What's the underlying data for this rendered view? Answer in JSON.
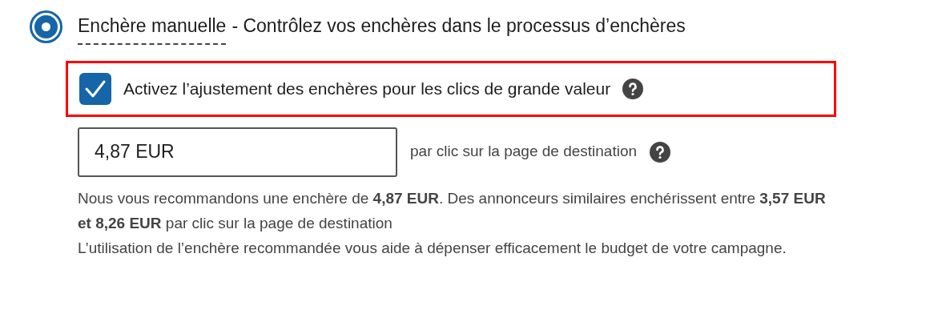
{
  "bid_option": {
    "selected": true,
    "term": "Enchère manuelle",
    "description": "- Contrôlez vos enchères dans le processus d’enchères"
  },
  "adjustment": {
    "highlighted": true,
    "checked": true,
    "label": "Activez l’ajustement des enchères pour les clics de grande valeur"
  },
  "bid_field": {
    "value": "4,87 EUR",
    "suffix": "par clic sur la page de destination"
  },
  "recommendation": "Nous vous recommandons une enchère de **4,87 EUR**. Des annonceurs similaires enchérissent entre **3,57 EUR et 8,26 EUR** par clic sur la page de destination\nL’utilisation de l’enchère recommandée vous aide à dépenser efficacement le budget de votre campagne."
}
